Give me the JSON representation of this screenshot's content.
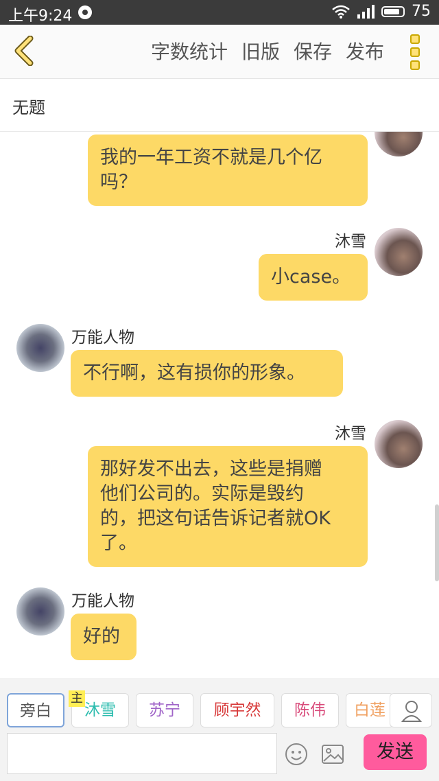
{
  "status_bar": {
    "time": "上午9:24",
    "battery": "75",
    "icons": [
      "notification-icon",
      "wifi-icon",
      "signal-icon",
      "battery-icon"
    ]
  },
  "toolbar": {
    "back_icon": "chevron-left-icon",
    "actions": [
      "字数统计",
      "旧版",
      "保存",
      "发布"
    ],
    "more_icon": "more-vertical-icon",
    "accent_color": "#ffe27a"
  },
  "document": {
    "title": "无题"
  },
  "messages": [
    {
      "sender": "",
      "side": "right",
      "text_lines": [
        "我的一年工资不就是几个亿",
        "吗？"
      ]
    },
    {
      "sender": "沐雪",
      "side": "right",
      "text_lines": [
        "小case。"
      ]
    },
    {
      "sender": "万能人物",
      "side": "left",
      "text_lines": [
        "不行啊，这有损你的形象。"
      ]
    },
    {
      "sender": "沐雪",
      "side": "right",
      "text_lines": [
        "那好发不出去，这些是捐赠",
        "他们公司的。实际是毁约",
        "的，把这句话告诉记者就OK",
        "了。"
      ]
    },
    {
      "sender": "万能人物",
      "side": "left",
      "text_lines": [
        "好的"
      ]
    }
  ],
  "bubble_color": "#fdd966",
  "roles": {
    "items": [
      {
        "label": "旁白",
        "color": "#555555"
      },
      {
        "label": "沐雪",
        "color": "#2bbcae"
      },
      {
        "label": "苏宁",
        "color": "#a064c8"
      },
      {
        "label": "顾宇然",
        "color": "#d83a3a"
      },
      {
        "label": "陈伟",
        "color": "#d84a7a"
      },
      {
        "label": "白莲",
        "color": "#f0a060"
      }
    ],
    "selected": "旁白",
    "host_badge": "主",
    "person_icon": "person-icon"
  },
  "composer": {
    "placeholder": "",
    "emoji_icon": "emoji-icon",
    "image_icon": "image-icon",
    "send_label": "发送",
    "send_color": "#ff5b9d"
  }
}
